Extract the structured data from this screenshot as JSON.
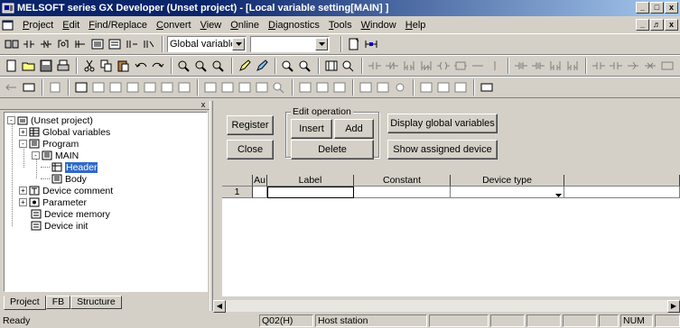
{
  "window": {
    "title": "MELSOFT series GX Developer (Unset project) - [Local variable setting[MAIN]  ]",
    "controls": [
      "_",
      "□",
      "x"
    ],
    "mdi_controls": [
      "_",
      "♬",
      "x"
    ]
  },
  "menu": {
    "items": [
      {
        "label": "Project",
        "key": "P"
      },
      {
        "label": "Edit",
        "key": "E"
      },
      {
        "label": "Find/Replace",
        "key": "F"
      },
      {
        "label": "Convert",
        "key": "C"
      },
      {
        "label": "View",
        "key": "V"
      },
      {
        "label": "Online",
        "key": "O"
      },
      {
        "label": "Diagnostics",
        "key": "D"
      },
      {
        "label": "Tools",
        "key": "T"
      },
      {
        "label": "Window",
        "key": "W"
      },
      {
        "label": "Help",
        "key": "H"
      }
    ]
  },
  "toolbar1": {
    "scope_select": "Global variable",
    "second_select": ""
  },
  "left_pane": {
    "close": "x",
    "tree": [
      {
        "label": "(Unset project)",
        "level": 0,
        "expander": "-",
        "icon": "project-icon"
      },
      {
        "label": "Global variables",
        "level": 1,
        "expander": "+",
        "icon": "table-icon"
      },
      {
        "label": "Program",
        "level": 1,
        "expander": "-",
        "icon": "program-icon"
      },
      {
        "label": "MAIN",
        "level": 2,
        "expander": "-",
        "icon": "program-icon"
      },
      {
        "label": "Header",
        "level": 3,
        "expander": "",
        "icon": "header-icon",
        "selected": true
      },
      {
        "label": "Body",
        "level": 3,
        "expander": "",
        "icon": "body-icon"
      },
      {
        "label": "Device comment",
        "level": 1,
        "expander": "+",
        "icon": "comment-icon"
      },
      {
        "label": "Parameter",
        "level": 1,
        "expander": "+",
        "icon": "parameter-icon"
      },
      {
        "label": "Device memory",
        "level": 1,
        "expander": "",
        "icon": "memory-icon"
      },
      {
        "label": "Device init",
        "level": 1,
        "expander": "",
        "icon": "init-icon"
      }
    ],
    "tabs": [
      {
        "label": "Project",
        "active": true
      },
      {
        "label": "FB",
        "active": false
      },
      {
        "label": "Structure",
        "active": false
      }
    ]
  },
  "editor": {
    "register": "Register",
    "close": "Close",
    "edit_group": "Edit operation",
    "insert": "Insert",
    "add": "Add",
    "delete": "Delete",
    "display_global": "Display global variables",
    "show_assigned": "Show assigned device",
    "grid": {
      "columns": [
        "",
        "Au",
        "Label",
        "Constant",
        "Device type",
        ""
      ],
      "rows": [
        {
          "num": "1",
          "au": "",
          "label": "",
          "constant": "",
          "device_type": "",
          "extra": ""
        }
      ]
    }
  },
  "status": {
    "ready": "Ready",
    "cpu": "Q02(H)",
    "station": "Host station",
    "num": "NUM"
  }
}
